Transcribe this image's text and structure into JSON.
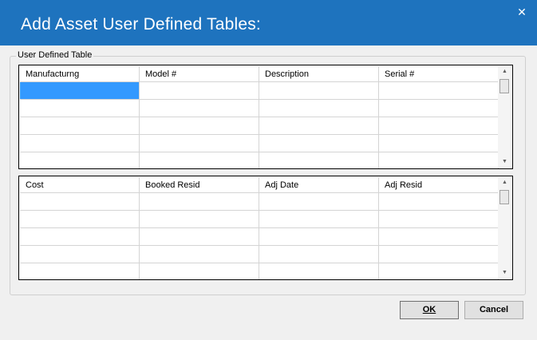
{
  "window": {
    "title": "Add Asset User Defined Tables:",
    "close_glyph": "✕"
  },
  "groupbox": {
    "label": "User Defined Table"
  },
  "table1": {
    "columns": [
      "Manufacturng",
      "Model #",
      "Description",
      "Serial #"
    ],
    "row_count": 5,
    "selected_cell": {
      "row": 0,
      "col": 0
    }
  },
  "table2": {
    "columns": [
      "Cost",
      "Booked Resid",
      "Adj Date",
      "Adj Resid"
    ],
    "row_count": 5
  },
  "scrollbar": {
    "up_glyph": "▲",
    "down_glyph": "▼"
  },
  "buttons": {
    "ok_label": "OK",
    "cancel_label": "Cancel"
  }
}
